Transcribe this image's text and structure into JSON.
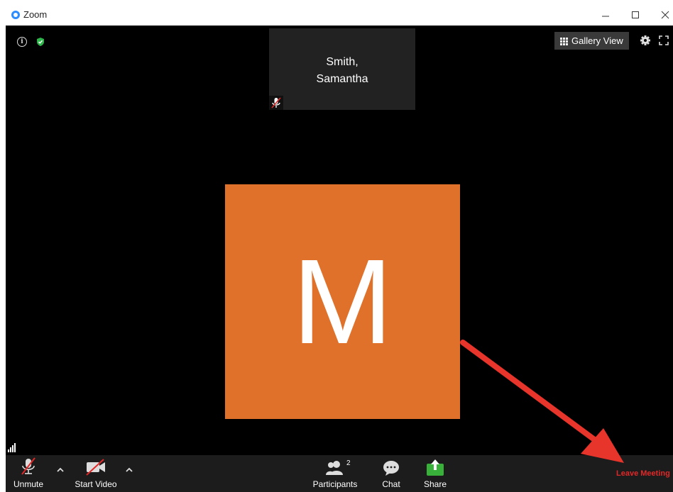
{
  "window": {
    "title": "Zoom",
    "controls": [
      "minimize-icon",
      "maximize-icon",
      "close-icon"
    ]
  },
  "top_bar": {
    "gallery_view_label": "Gallery View",
    "icons": [
      "info-icon",
      "shield-check-icon",
      "grid-icon",
      "gear-icon",
      "fullscreen-icon"
    ]
  },
  "thumbnail": {
    "name_line1": "Smith,",
    "name_line2": "Samantha",
    "icon": "mic-muted-icon"
  },
  "avatar": {
    "letter": "M",
    "color": "#e0712b"
  },
  "toolbar": {
    "unmute_label": "Unmute",
    "start_video_label": "Start Video",
    "participants_label": "Participants",
    "participants_count": "2",
    "chat_label": "Chat",
    "share_label": "Share",
    "leave_label": "Leave Meeting"
  },
  "colors": {
    "accent_blue": "#2d8cff",
    "share_green": "#38b03a",
    "leave_red": "#e02828",
    "annotation_arrow": "#e8352b",
    "meeting_bg": "#000000",
    "toolbar_bg": "#1c1c1c"
  }
}
